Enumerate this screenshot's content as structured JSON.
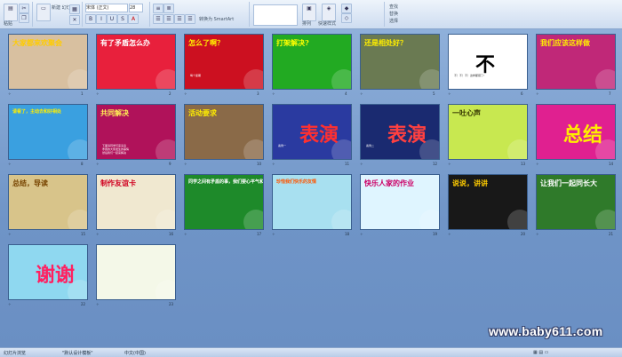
{
  "ribbon": {
    "font_name": "宋体 (正文)",
    "font_size": "28",
    "paste_label": "粘贴",
    "new_slide_label": "新建\n幻灯片",
    "smartart_label": "转换为 SmartArt",
    "arrange_label": "排列",
    "quick_styles_label": "快速样式",
    "find_label": "查找",
    "replace_label": "替换",
    "select_label": "选择"
  },
  "slides": [
    {
      "n": 1,
      "caption": "大家都来欢聚会",
      "cap_color": "#ffcc00",
      "bg": "#d8c0a0"
    },
    {
      "n": 2,
      "caption": "有了矛盾怎么办",
      "cap_color": "#ffffff",
      "bg": "#e8203c"
    },
    {
      "n": 3,
      "caption": "怎么了啊？",
      "sub": "每个星期",
      "cap_color": "#ffee00",
      "bg": "#cc1020"
    },
    {
      "n": 4,
      "caption": "打架解决?",
      "cap_color": "#ffff00",
      "bg": "#22aa22"
    },
    {
      "n": 5,
      "caption": "还是相处好？",
      "cap_color": "#ffee00",
      "bg": "#6a7a52"
    },
    {
      "n": 6,
      "caption": "不",
      "sub": "不！不！不！这样都错了!",
      "cap_color": "#000000",
      "bg": "#ffffff"
    },
    {
      "n": 7,
      "caption": "我们应该这样做",
      "cap_color": "#ffee00",
      "bg": "#c02878"
    },
    {
      "n": 8,
      "caption": "请看了，主动去和好相处",
      "cap_color": "#ffee00",
      "bg": "#3aa0e0"
    },
    {
      "n": 9,
      "caption": "共同解决",
      "sub": "下面请同学们来演演\n矛盾的大家发生的事情\n然后我们一起来解决",
      "cap_color": "#ffee55",
      "bg": "#b0125a"
    },
    {
      "n": 10,
      "caption": "活动要求",
      "cap_color": "#ffee00",
      "bg": "#8a6a48"
    },
    {
      "n": 11,
      "caption": "表演",
      "sub": "案例一",
      "cap_color": "#ff3030",
      "bg": "#2a3aa0"
    },
    {
      "n": 12,
      "caption": "表演",
      "sub": "案例二",
      "cap_color": "#ff4040",
      "bg": "#1a2a70"
    },
    {
      "n": 13,
      "caption": "一吐心声",
      "cap_color": "#333300",
      "bg": "#c8e850"
    },
    {
      "n": 14,
      "caption": "总结",
      "cap_color": "#ffee00",
      "bg": "#e02090"
    },
    {
      "n": 15,
      "caption": "总结，导读",
      "cap_color": "#774400",
      "bg": "#d8c48a"
    },
    {
      "n": 16,
      "caption": "制作友谊卡",
      "cap_color": "#d00020",
      "bg": "#f0e8d0"
    },
    {
      "n": 17,
      "caption": "同学之间有矛盾的事，我们要心平气和",
      "cap_color": "#ffffff",
      "bg": "#1e8a2a"
    },
    {
      "n": 18,
      "caption": "珍惜我们快乐的友情",
      "cap_color": "#ff5500",
      "bg": "#a8e0f0"
    },
    {
      "n": 19,
      "caption": "快乐人家的作业",
      "cap_color": "#cc0066",
      "bg": "#dff5ff"
    },
    {
      "n": 20,
      "caption": "说说，讲讲",
      "cap_color": "#ffcc00",
      "bg": "#181818"
    },
    {
      "n": 21,
      "caption": "让我们一起同长大",
      "cap_color": "#ffffff",
      "bg": "#2f7a2a"
    },
    {
      "n": 22,
      "caption": "谢谢",
      "cap_color": "#ff2060",
      "bg": "#8fd8f0"
    },
    {
      "n": 23,
      "caption": "",
      "cap_color": "#333333",
      "bg": "#f4f8e8"
    }
  ],
  "status": {
    "left": "幻灯片浏览",
    "theme": "\"默认设计模板\"",
    "lang": "中文(中国)"
  },
  "watermark": "www.baby611.com",
  "colors": {
    "sorter_bg": "#6f95c6",
    "ribbon_bg": "#dbe6f5",
    "accent": "#3a5f8f"
  }
}
